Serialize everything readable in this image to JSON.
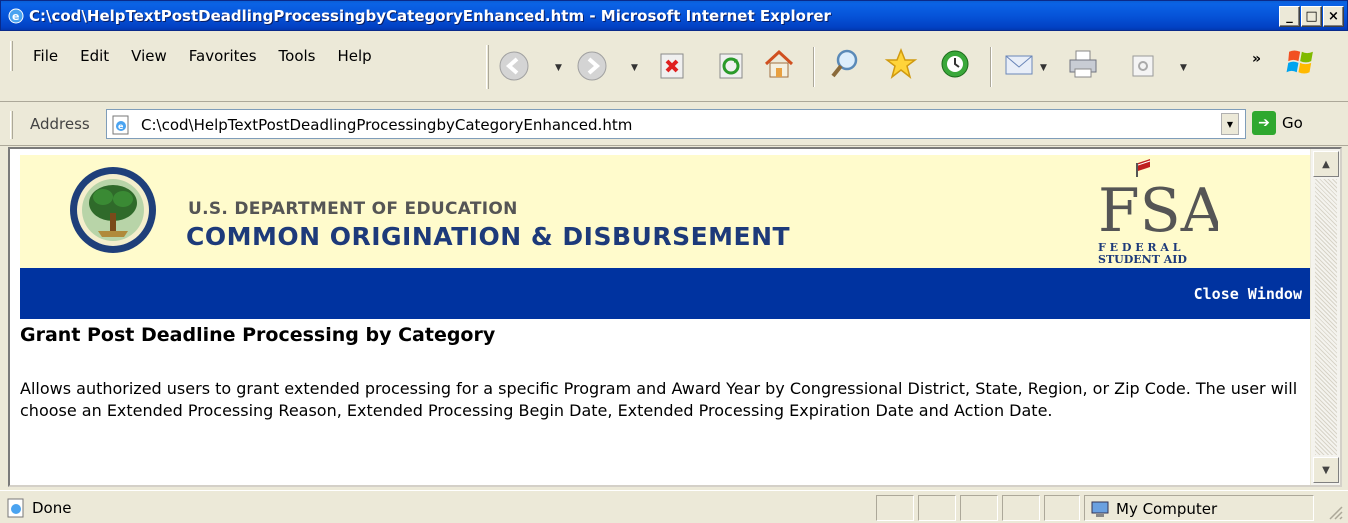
{
  "window": {
    "title": "C:\\cod\\HelpTextPostDeadlingProcessingbyCategoryEnhanced.htm - Microsoft Internet Explorer",
    "minimize": "_",
    "maximize": "□",
    "close": "×"
  },
  "menu": {
    "items": [
      "File",
      "Edit",
      "View",
      "Favorites",
      "Tools",
      "Help"
    ]
  },
  "toolbar": {
    "chevron": "»"
  },
  "address": {
    "label": "Address",
    "url": "C:\\cod\\HelpTextPostDeadlingProcessingbyCategoryEnhanced.htm",
    "go_label": "Go"
  },
  "page": {
    "dept_name": "U.S. DEPARTMENT OF EDUCATION",
    "system_name": "COMMON ORIGINATION & DISBURSEMENT",
    "fsa_text": "FSA",
    "fsa_sub1": "F E D E R A L",
    "fsa_sub2": "STUDENT AID",
    "close_window": "Close Window",
    "heading": "Grant Post Deadline Processing by Category",
    "description": "Allows authorized users to grant extended processing for a specific Program and Award Year by Congressional District, State, Region, or Zip Code. The user will choose an Extended Processing Reason, Extended Processing Begin Date, Extended Processing Expiration Date and Action Date."
  },
  "status": {
    "text": "Done",
    "zone": "My Computer"
  },
  "colors": {
    "titlebar": "#0654d9",
    "banner_bg": "#fffbcc",
    "nav_bar": "#0033a0",
    "cod_text": "#1d3a7a"
  }
}
